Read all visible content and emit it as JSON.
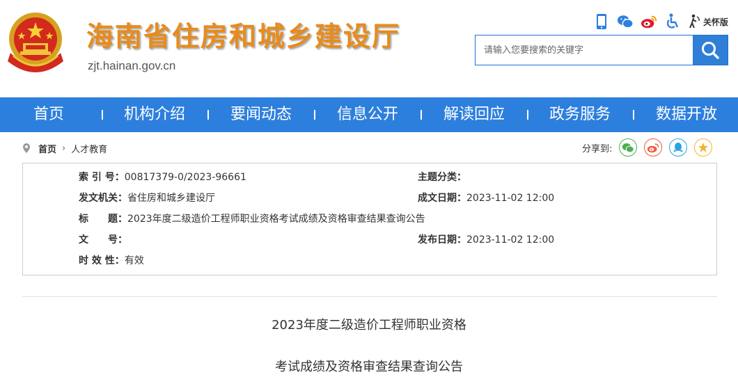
{
  "header": {
    "title": "海南省住房和城乡建设厅",
    "url": "zjt.hainan.gov.cn",
    "care_label": "关怀版",
    "icons": [
      "mobile-icon",
      "wechat-icon",
      "weibo-icon",
      "accessibility-icon",
      "elder-care-icon"
    ]
  },
  "search": {
    "placeholder": "请输入您要搜索的关键字"
  },
  "nav": {
    "items": [
      "首页",
      "机构介绍",
      "要闻动态",
      "信息公开",
      "解读回应",
      "政务服务",
      "数据开放"
    ],
    "separator": "|"
  },
  "breadcrumb": {
    "home": "首页",
    "arrow": "›",
    "current": "人才教育"
  },
  "share": {
    "label": "分享到:",
    "targets": [
      "wechat",
      "weibo",
      "qq",
      "favorite"
    ]
  },
  "meta": {
    "index_label": "索 引 号：",
    "index_value": "00817379-0/2023-96661",
    "topic_label": "主题分类：",
    "topic_value": "",
    "issuer_label": "发文机关：",
    "issuer_value": "省住房和城乡建设厅",
    "created_label": "成文日期：",
    "created_value": "2023-11-02 12:00",
    "title_label": "标　　题：",
    "title_value": "2023年度二级造价工程师职业资格考试成绩及资格审查结果查询公告",
    "docno_label": "文　　号：",
    "docno_value": "",
    "published_label": "发布日期：",
    "published_value": "2023-11-02 12:00",
    "validity_label": "时 效 性：",
    "validity_value": "有效"
  },
  "article": {
    "title_line1": "2023年度二级造价工程师职业资格",
    "title_line2": "考试成绩及资格审查结果查询公告"
  },
  "colors": {
    "nav_bg": "#2d7fde",
    "title_orange": "#e88b1c",
    "search_btn": "#2f7fd6"
  }
}
